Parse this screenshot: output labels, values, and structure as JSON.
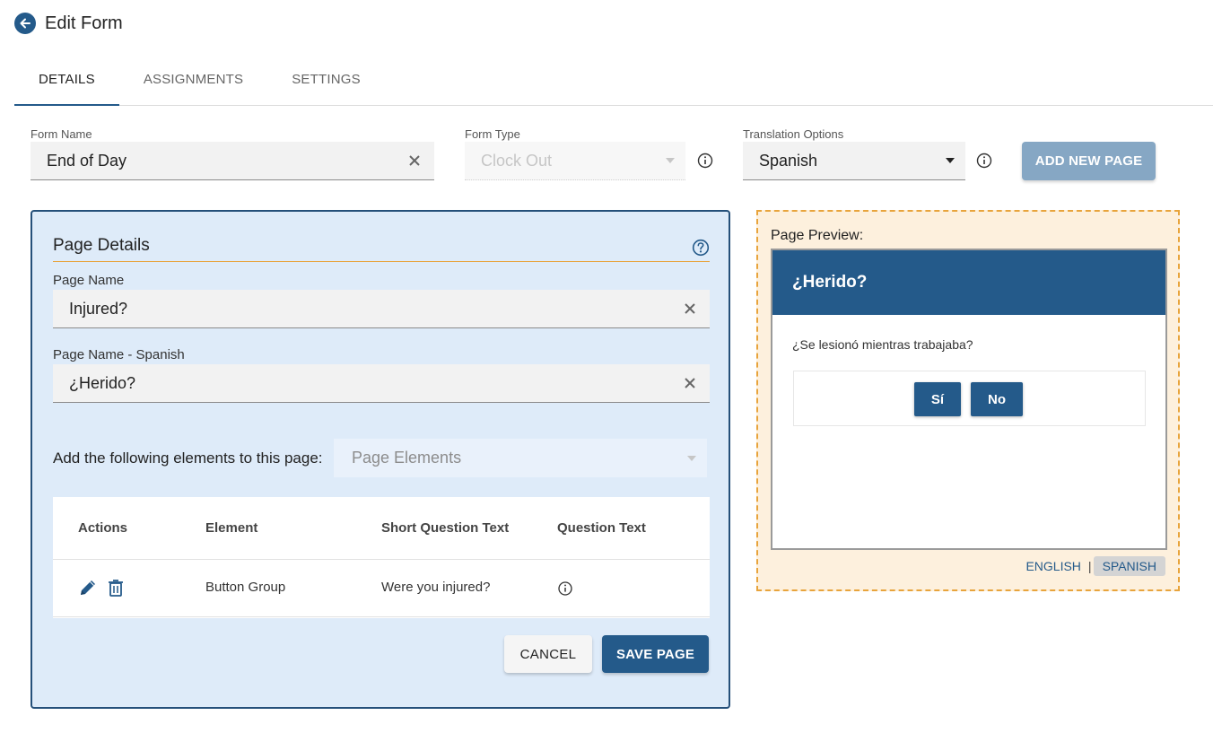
{
  "header": {
    "title": "Edit Form"
  },
  "tabs": [
    {
      "label": "DETAILS",
      "active": true
    },
    {
      "label": "ASSIGNMENTS",
      "active": false
    },
    {
      "label": "SETTINGS",
      "active": false
    }
  ],
  "form": {
    "name_label": "Form Name",
    "name_value": "End of Day",
    "type_label": "Form Type",
    "type_value": "Clock Out",
    "translation_label": "Translation Options",
    "translation_value": "Spanish",
    "add_page_label": "ADD NEW PAGE"
  },
  "page_details": {
    "title": "Page Details",
    "page_name_label": "Page Name",
    "page_name_value": "Injured?",
    "page_name_es_label": "Page Name - Spanish",
    "page_name_es_value": "¿Herido?",
    "elements_label": "Add the following elements to this page:",
    "elements_placeholder": "Page Elements",
    "table": {
      "columns": [
        "Actions",
        "Element",
        "Short Question Text",
        "Question Text"
      ],
      "rows": [
        {
          "element": "Button Group",
          "short_text": "Were you injured?"
        }
      ]
    },
    "cancel_label": "CANCEL",
    "save_label": "SAVE PAGE"
  },
  "preview": {
    "label": "Page Preview:",
    "screen_title": "¿Herido?",
    "question": "¿Se lesionó mientras trabajaba?",
    "buttons": [
      "Sí",
      "No"
    ],
    "lang_english": "ENGLISH",
    "lang_separator": "|",
    "lang_spanish": "SPANISH",
    "active_language": "SPANISH"
  },
  "colors": {
    "primary": "#245a8a",
    "panel_bg": "#deebf9",
    "preview_bg": "#fdf0dd",
    "accent": "#e8a43c"
  }
}
